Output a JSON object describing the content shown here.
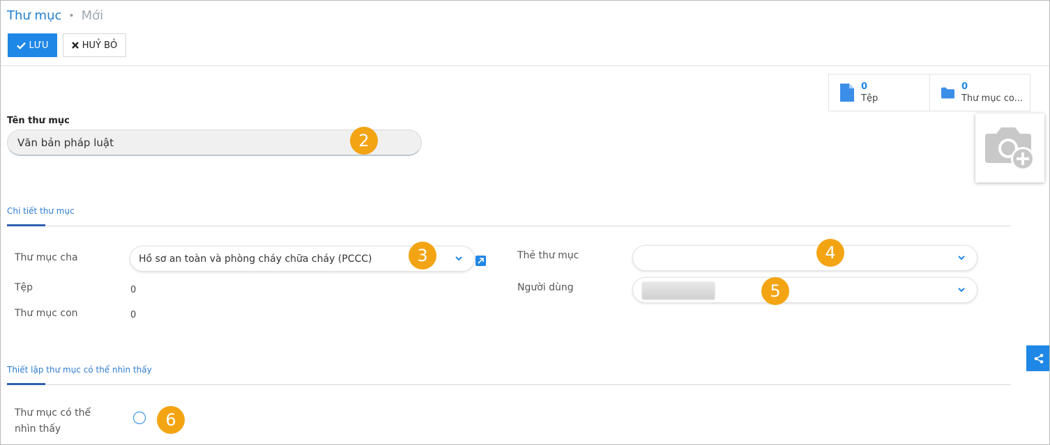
{
  "header": {
    "breadcrumb_parent": "Thư mục",
    "breadcrumb_separator": "•",
    "breadcrumb_current": "Mới",
    "save_label": "LƯU",
    "cancel_label": "HUỶ BỎ"
  },
  "stats": [
    {
      "count": "0",
      "label": "Tệp",
      "icon": "file-icon"
    },
    {
      "count": "0",
      "label": "Thư mục co...",
      "icon": "folder-icon"
    }
  ],
  "form": {
    "name_label": "Tên thư mục",
    "name_value": "Văn bản pháp luật"
  },
  "tabs": {
    "details": "Chi tiết thư mục",
    "visibility": "Thiết lập thư mục có thể nhìn thấy"
  },
  "details": {
    "parent_label": "Thư mục cha",
    "parent_value": "Hồ sơ an toàn và phòng cháy chữa cháy (PCCC)",
    "files_label": "Tệp",
    "files_value": "0",
    "subfolders_label": "Thư mục con",
    "subfolders_value": "0",
    "tags_label": "Thẻ thư mục",
    "tags_value": "",
    "users_label": "Người dùng"
  },
  "visibility": {
    "visible_label_line1": "Thư mục có thể",
    "visible_label_line2": "nhìn thấy"
  },
  "annotations": [
    "2",
    "3",
    "4",
    "5",
    "6"
  ],
  "colors": {
    "accent": "#1f87e6",
    "badge": "#f3a413",
    "link": "#1e7fd0"
  }
}
